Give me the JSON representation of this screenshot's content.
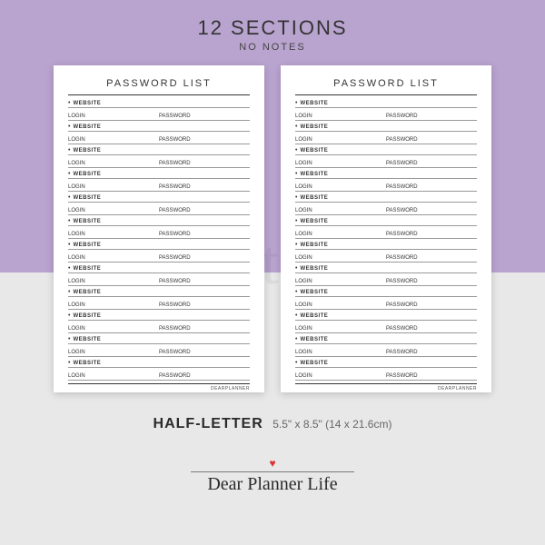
{
  "header": {
    "title": "12 SECTIONS",
    "subtitle": "NO NOTES"
  },
  "page": {
    "title": "PASSWORD LIST",
    "website_label": "WEBSITE",
    "login_label": "LOGIN",
    "password_label": "PASSWORD",
    "footer": "DEARPLANNER",
    "section_count": 12
  },
  "watermark": "printable",
  "size": {
    "name": "HALF-LETTER",
    "dims": "5.5\" x 8.5\" (14 x 21.6cm)"
  },
  "brand": "Dear Planner Life"
}
